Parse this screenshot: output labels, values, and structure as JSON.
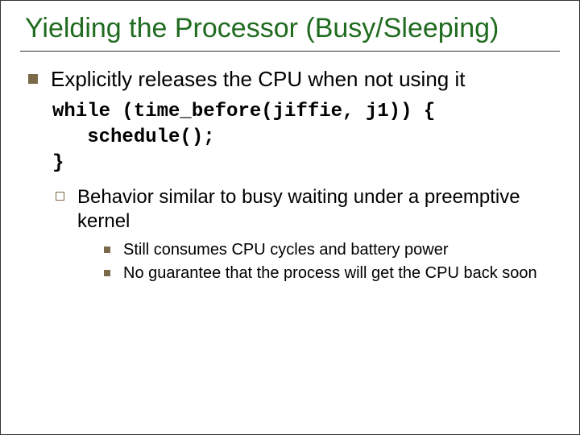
{
  "title": "Yielding the Processor (Busy/Sleeping)",
  "lvl1_text": "Explicitly releases the CPU when not using it",
  "code": "while (time_before(jiffie, j1)) {\n   schedule();\n}",
  "lvl2_text": "Behavior similar to busy waiting under a preemptive kernel",
  "lvl3_items": [
    "Still consumes CPU cycles and battery power",
    "No guarantee that the process will get the CPU back soon"
  ]
}
